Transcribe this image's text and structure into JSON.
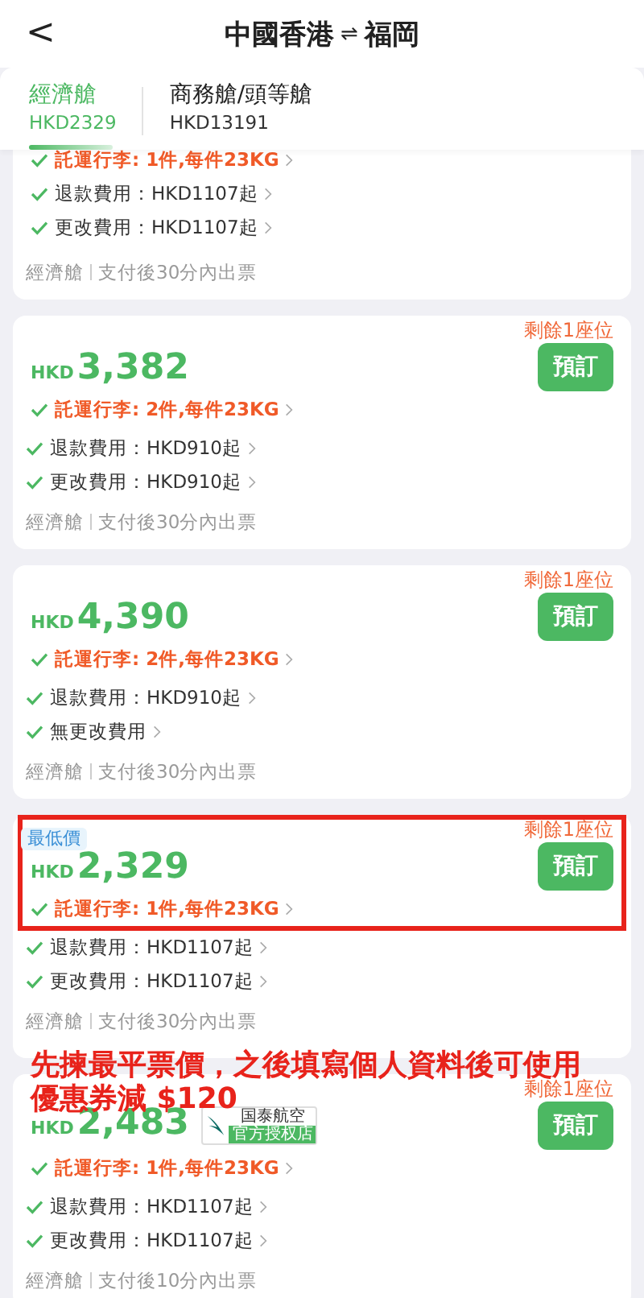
{
  "header": {
    "back": "<",
    "origin": "中國香港",
    "swap": "⇌",
    "destination": "福岡"
  },
  "tabs": [
    {
      "label": "經濟艙",
      "price": "HKD2329",
      "selected": true
    },
    {
      "label": "商務艙/頭等艙",
      "price": "HKD13191",
      "selected": false
    }
  ],
  "cards": [
    {
      "partial": true,
      "rows": [
        {
          "kind": "baggage",
          "text": "託運行李: 1件,每件23KG"
        },
        {
          "kind": "fee",
          "text": "退款費用：HKD1107起"
        },
        {
          "kind": "fee",
          "text": "更改費用：HKD1107起"
        }
      ],
      "cabin": "經濟艙",
      "ticketing": "支付後30分內出票"
    },
    {
      "seats": "剩餘1座位",
      "currency": "HKD",
      "price": "3,382",
      "button": "預訂",
      "rows": [
        {
          "kind": "baggage",
          "text": "託運行李: 2件,每件23KG"
        },
        {
          "kind": "fee",
          "text": "退款費用：HKD910起"
        },
        {
          "kind": "fee",
          "text": "更改費用：HKD910起"
        }
      ],
      "cabin": "經濟艙",
      "ticketing": "支付後30分內出票"
    },
    {
      "seats": "剩餘1座位",
      "currency": "HKD",
      "price": "4,390",
      "button": "預訂",
      "rows": [
        {
          "kind": "baggage",
          "text": "託運行李: 2件,每件23KG"
        },
        {
          "kind": "fee",
          "text": "退款費用：HKD910起"
        },
        {
          "kind": "fee",
          "text": "無更改費用"
        }
      ],
      "cabin": "經濟艙",
      "ticketing": "支付後30分內出票"
    },
    {
      "badge": "最低價",
      "highlighted": true,
      "seats": "剩餘1座位",
      "currency": "HKD",
      "price": "2,329",
      "button": "預訂",
      "rows": [
        {
          "kind": "baggage",
          "text": "託運行李: 1件,每件23KG"
        },
        {
          "kind": "fee",
          "text": "退款費用：HKD1107起"
        },
        {
          "kind": "fee",
          "text": "更改費用：HKD1107起"
        }
      ],
      "cabin": "經濟艙",
      "ticketing": "支付後30分內出票"
    },
    {
      "seats": "剩餘1座位",
      "currency": "HKD",
      "price": "2,483",
      "airline": {
        "name": "国泰航空",
        "tag": "官方授权店"
      },
      "button": "預訂",
      "rows": [
        {
          "kind": "baggage",
          "text": "託運行李: 1件,每件23KG"
        },
        {
          "kind": "fee",
          "text": "退款費用：HKD1107起"
        },
        {
          "kind": "fee",
          "text": "更改費用：HKD1107起"
        }
      ],
      "cabin": "經濟艙",
      "ticketing": "支付後10分內出票"
    }
  ],
  "annotation": {
    "lines": [
      "先揀最平票價，之後填寫個人資料後可使用",
      "優惠券減 $120"
    ]
  }
}
